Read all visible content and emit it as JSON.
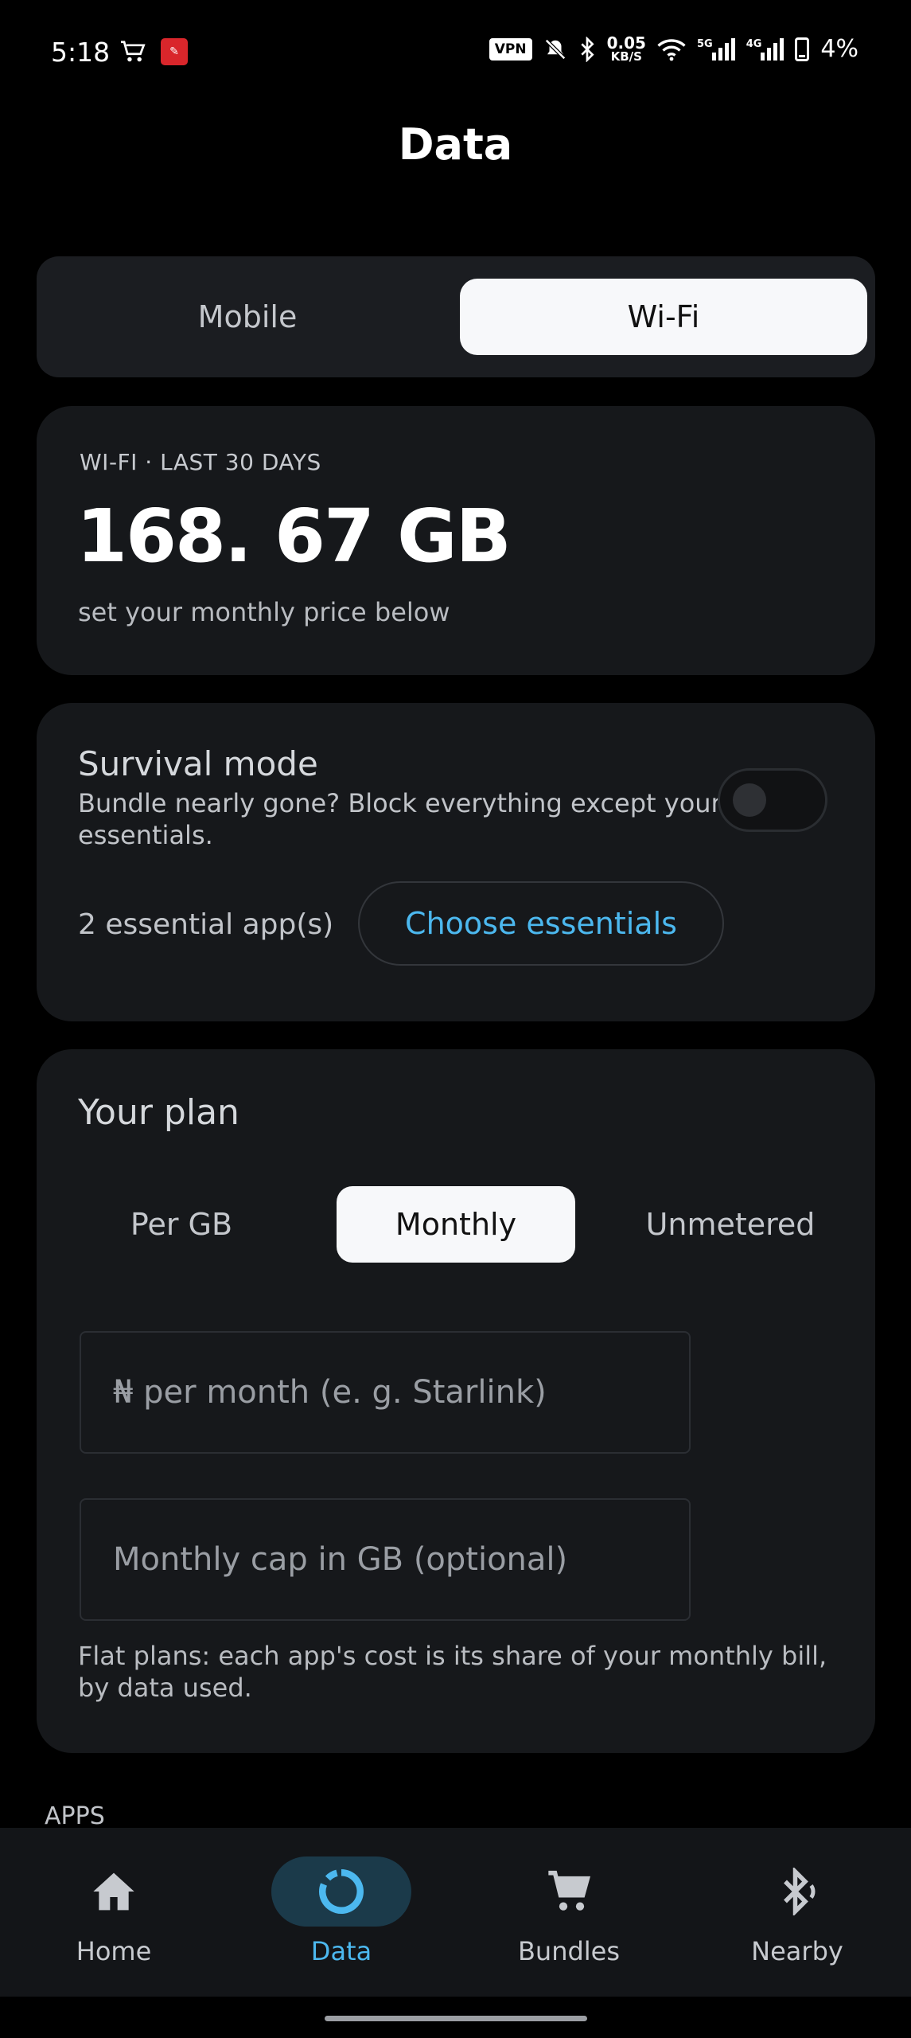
{
  "status_bar": {
    "time": "5:18",
    "vpn": "VPN",
    "speed_value": "0.05",
    "speed_unit": "KB/S",
    "net1": "5G",
    "net2": "4G",
    "battery": "4%"
  },
  "header": {
    "title": "Data"
  },
  "network_toggle": {
    "options": [
      "Mobile",
      "Wi-Fi"
    ],
    "selected": "Wi-Fi"
  },
  "usage": {
    "label": "WI-FI · LAST 30 DAYS",
    "value": "168. 67 GB",
    "hint": "set your monthly price below"
  },
  "survival": {
    "title": "Survival mode",
    "description": "Bundle nearly gone?  Block everything except your essentials.",
    "enabled": false,
    "essentials_count": "2 essential app(s)",
    "choose_label": "Choose essentials"
  },
  "plan": {
    "title": "Your plan",
    "tabs": [
      "Per GB",
      "Monthly",
      "Unmetered"
    ],
    "selected": "Monthly",
    "price_placeholder": "₦ per month (e. g.  Starlink)",
    "cap_placeholder": "Monthly cap in GB (optional)",
    "note": "Flat plans: each app's cost is its share of your monthly bill, by data used."
  },
  "apps_section": {
    "label": "APPS"
  },
  "bottom_nav": {
    "items": [
      {
        "label": "Home",
        "icon": "home-icon"
      },
      {
        "label": "Data",
        "icon": "data-ring-icon"
      },
      {
        "label": "Bundles",
        "icon": "cart-icon"
      },
      {
        "label": "Nearby",
        "icon": "bluetooth-icon"
      }
    ],
    "active": "Data",
    "accent": "#4cb8ef"
  }
}
